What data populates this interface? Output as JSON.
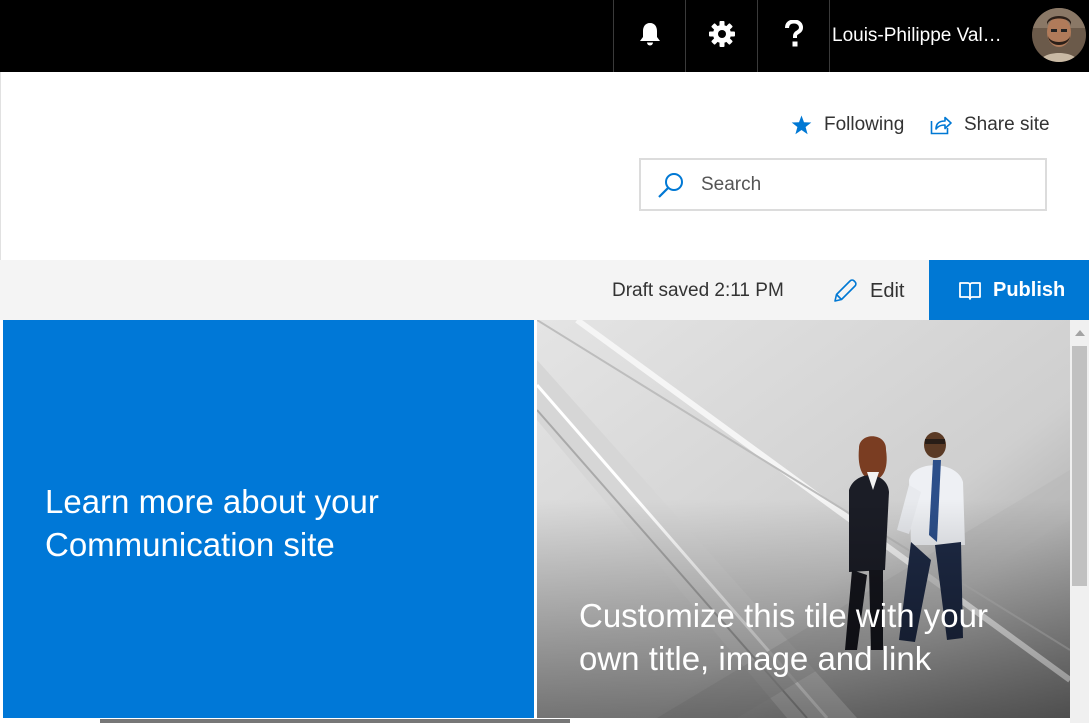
{
  "suite_bar": {
    "notifications_icon": "bell-icon",
    "settings_icon": "gear-icon",
    "help_icon": "question-icon",
    "user_name": "Louis-Philippe Val…"
  },
  "site_header": {
    "following_label": "Following",
    "share_label": "Share site",
    "search_placeholder": "Search"
  },
  "command_bar": {
    "draft_status": "Draft saved 2:11 PM",
    "edit_label": "Edit",
    "publish_label": "Publish"
  },
  "hero": {
    "tiles": [
      {
        "title": "Learn more about your Communication site"
      },
      {
        "title": "Customize this tile with your own title, image and link"
      }
    ]
  },
  "colors": {
    "accent": "#0078d4",
    "tile_blue": "#0078d7",
    "suite_bar": "#000000",
    "command_bar": "#f4f4f4"
  }
}
